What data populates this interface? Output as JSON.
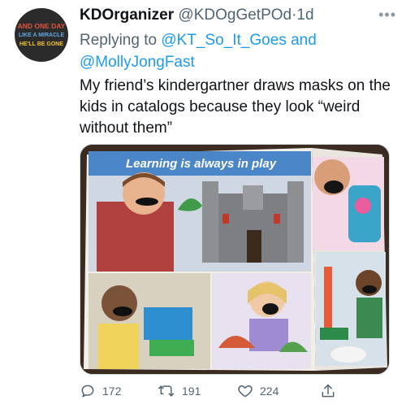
{
  "avatar": {
    "line1": "AND ONE DAY",
    "line2": "LIKE A MIRACLE",
    "line3": "HE'LL BE GONE"
  },
  "tweet": {
    "name": "KDOrganizer",
    "handle": "@KDOgGetPOd",
    "separator": "·",
    "time": "1d",
    "replying_prefix": "Replying to",
    "replying_to_1": "@KT_So_It_Goes",
    "replying_and": "and",
    "replying_to_2": "@MollyJongFast",
    "text": "My friend’s kindergartner draws masks on the kids in catalogs because they look “weird without them”"
  },
  "media": {
    "headline": "Learning is always in play"
  },
  "actions": {
    "replies": "172",
    "retweets": "191",
    "likes": "224"
  },
  "icons": [
    "more-icon",
    "reply-icon",
    "retweet-icon",
    "like-icon",
    "share-icon"
  ],
  "colors": {
    "link": "#1d9bf0",
    "muted": "#536471",
    "text": "#0f1419"
  }
}
